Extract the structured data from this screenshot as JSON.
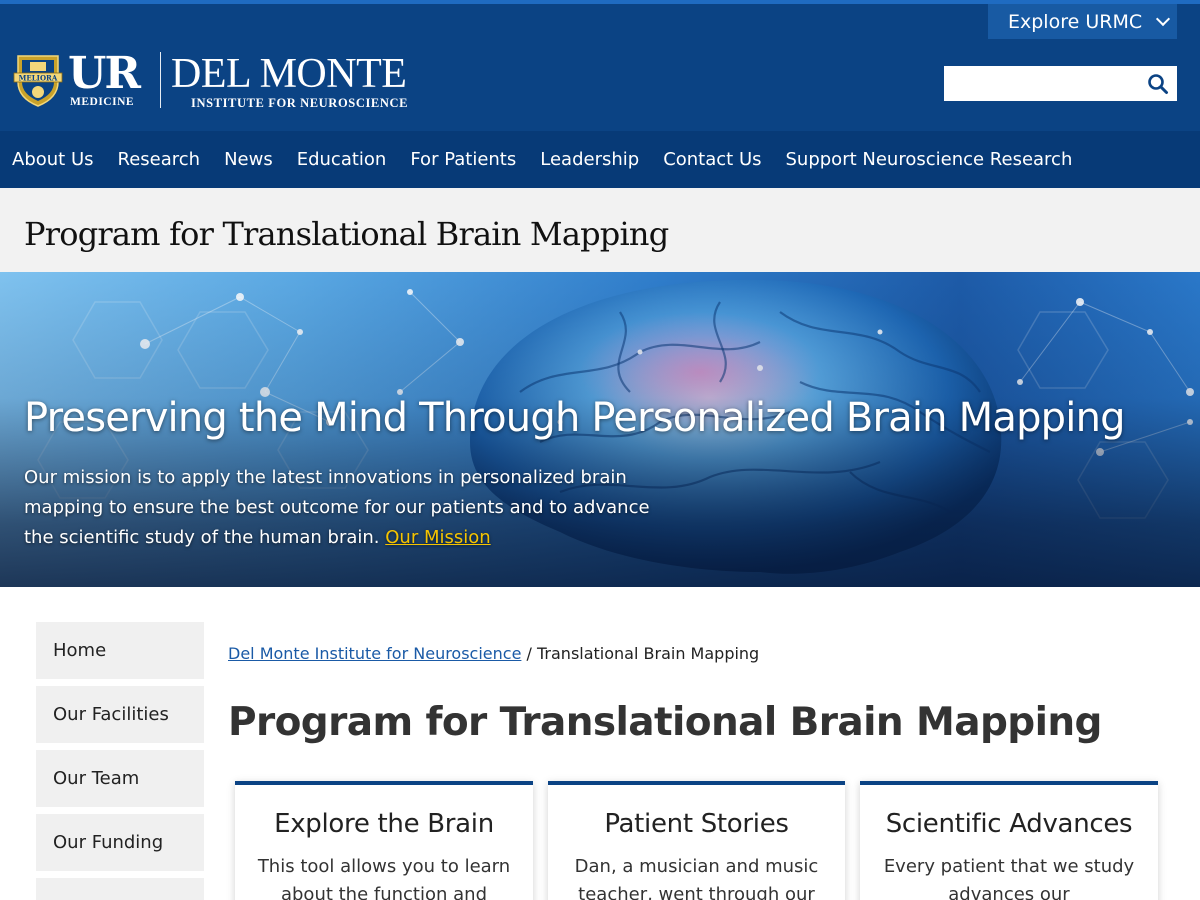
{
  "header": {
    "explore_label": "Explore URMC",
    "search_placeholder": "",
    "logo": {
      "ur": "UR",
      "ur_sub": "MEDICINE",
      "dm": "DEL MONTE",
      "dm_sub": "INSTITUTE FOR NEUROSCIENCE",
      "seal_text": "MELIORA"
    }
  },
  "nav": {
    "items": [
      "About Us",
      "Research",
      "News",
      "Education",
      "For Patients",
      "Leadership",
      "Contact Us",
      "Support Neuroscience Research"
    ]
  },
  "title_band": {
    "title": "Program for Translational Brain Mapping"
  },
  "hero": {
    "heading": "Preserving the Mind Through Personalized Brain Mapping",
    "text": "Our mission is to apply the latest innovations in personalized brain mapping to ensure the best outcome for our patients and to advance the scientific study of the human brain.",
    "link": "Our Mission"
  },
  "sidebar": {
    "items": [
      "Home",
      "Our Facilities",
      "Our Team",
      "Our Funding",
      ""
    ]
  },
  "breadcrumb": {
    "link": "Del Monte Institute for Neuroscience",
    "separator": "/",
    "current": "Translational Brain Mapping"
  },
  "main": {
    "title": "Program for Translational Brain Mapping"
  },
  "cards": [
    {
      "title": "Explore the Brain",
      "text": "This tool allows you to learn about the function and"
    },
    {
      "title": "Patient Stories",
      "text": "Dan, a musician and music teacher, went through our"
    },
    {
      "title": "Scientific Advances",
      "text": "Every patient that we study advances our understanding"
    }
  ],
  "colors": {
    "header": "#0b4384",
    "nav": "#073a77",
    "link": "#1a5aa6",
    "hero_link": "#f5c400"
  }
}
